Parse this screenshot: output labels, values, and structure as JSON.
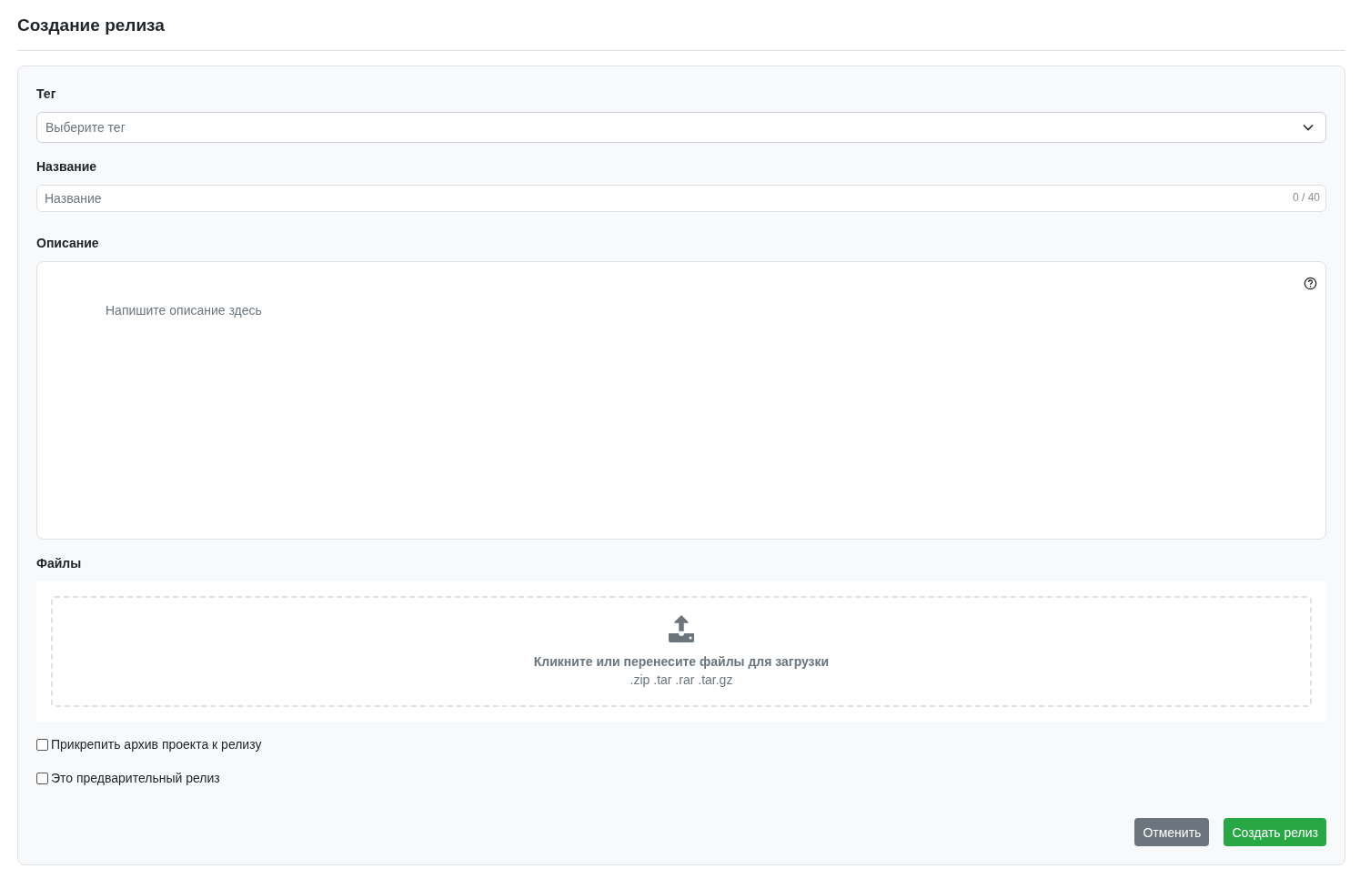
{
  "page": {
    "title": "Создание релиза"
  },
  "tag": {
    "label": "Тег",
    "placeholder": "Выберите тег"
  },
  "name": {
    "label": "Название",
    "placeholder": "Название",
    "counter": "0 / 40"
  },
  "description": {
    "label": "Описание",
    "placeholder": "Напишите описание здесь"
  },
  "files": {
    "label": "Файлы",
    "prompt": "Кликните или перенесите файлы для загрузки",
    "formats": ".zip .tar .rar .tar.gz"
  },
  "options": [
    {
      "label": "Прикрепить архив проекта к релизу",
      "checked": false
    },
    {
      "label": "Это предварительный релиз",
      "checked": false
    }
  ],
  "buttons": [
    {
      "label": "Отменить",
      "kind": "secondary"
    },
    {
      "label": "Создать релиз",
      "kind": "primary"
    }
  ]
}
